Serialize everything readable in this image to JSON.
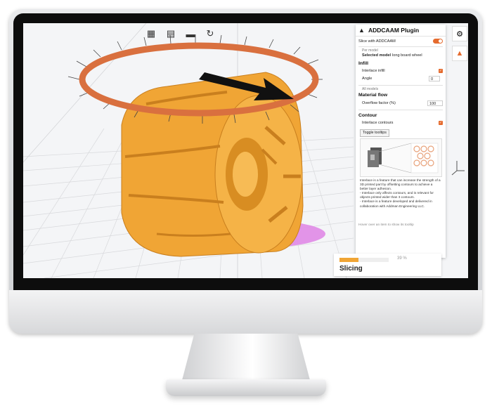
{
  "toolbar": {
    "icons": [
      "printer-settings-icon",
      "layers-settings-icon",
      "camera-icon",
      "rotate-icon"
    ]
  },
  "panel": {
    "title": "ADDCAAM Plugin",
    "slice_label": "Slice with ADDCAAM",
    "per_model": "Per model",
    "selected_model_key": "Selected model",
    "selected_model_value": "long board wheel",
    "infill_title": "Infill",
    "interlace_infill": "Interlace infill",
    "angle_label": "Angle",
    "angle_value": "0",
    "all_models": "All models",
    "material_flow_title": "Material flow",
    "overflow_label": "Overflow factor (%)",
    "overflow_value": "100",
    "contour_title": "Contour",
    "interlace_contours": "Interlace contours",
    "toggle_tooltips": "Toggle tooltips",
    "tooltip_text": "Interlace is a feature that can increase the strength of a 3D printed part by offsetting contours to achieve a better layer adhesion.\n- Interlace only affects contours, and is relevant for objects printed wider than 3 contours.\n- Interlace is a feature developed and delivered in collaboration with Addman Engineering LLC.",
    "hover_hint": "Hover over an item to show its tooltip"
  },
  "slicing": {
    "label": "Slicing",
    "percent_text": "39 %",
    "progress": 0.39
  },
  "colors": {
    "accent": "#e56b2e",
    "model": "#f0a535",
    "ring": "#d9703f"
  }
}
